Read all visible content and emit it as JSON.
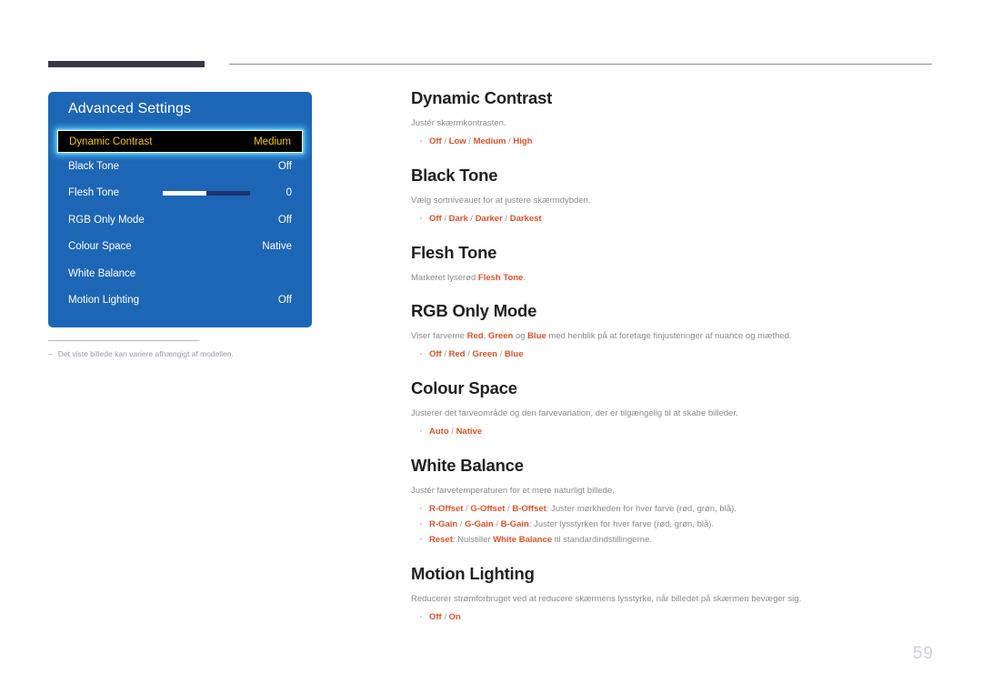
{
  "page": {
    "number": "59"
  },
  "osd": {
    "title": "Advanced Settings",
    "rows": [
      {
        "label": "Dynamic Contrast",
        "value": "Medium",
        "selected": true,
        "slider": false
      },
      {
        "label": "Black Tone",
        "value": "Off",
        "selected": false,
        "slider": false
      },
      {
        "label": "Flesh Tone",
        "value": "0",
        "selected": false,
        "slider": true
      },
      {
        "label": "RGB Only Mode",
        "value": "Off",
        "selected": false,
        "slider": false
      },
      {
        "label": "Colour Space",
        "value": "Native",
        "selected": false,
        "slider": false
      },
      {
        "label": "White Balance",
        "value": "",
        "selected": false,
        "slider": false
      },
      {
        "label": "Motion Lighting",
        "value": "Off",
        "selected": false,
        "slider": false
      }
    ],
    "slider_value_percent": 50
  },
  "footnote": {
    "dash": "–",
    "text": "Det viste billede kan variere afhængigt af modellen."
  },
  "sections": [
    {
      "title": "Dynamic Contrast",
      "desc": "Justér skærmkontrasten.",
      "bullets": [
        {
          "options": [
            "Off",
            "Low",
            "Medium",
            "High"
          ],
          "trail": ""
        }
      ]
    },
    {
      "title": "Black Tone",
      "desc": "Vælg sortniveauet for at justere skærmdybden.",
      "bullets": [
        {
          "options": [
            "Off",
            "Dark",
            "Darker",
            "Darkest"
          ],
          "trail": ""
        }
      ]
    },
    {
      "title": "Flesh Tone",
      "desc_parts": [
        {
          "text": "Markeret lyserød ",
          "accent": false
        },
        {
          "text": "Flesh Tone",
          "accent": true
        },
        {
          "text": ".",
          "accent": false
        }
      ],
      "bullets": []
    },
    {
      "title": "RGB Only Mode",
      "desc_parts": [
        {
          "text": "Viser farverne ",
          "accent": false
        },
        {
          "text": "Red",
          "accent": true
        },
        {
          "text": ", ",
          "accent": false
        },
        {
          "text": "Green",
          "accent": true
        },
        {
          "text": " og ",
          "accent": false
        },
        {
          "text": "Blue",
          "accent": true
        },
        {
          "text": " med henblik på at foretage finjusteringer af nuance og mæthed.",
          "accent": false
        }
      ],
      "bullets": [
        {
          "options": [
            "Off",
            "Red",
            "Green",
            "Blue"
          ],
          "trail": ""
        }
      ]
    },
    {
      "title": "Colour Space",
      "desc": "Justerer det farveområde og den farvevariation, der er tilgængelig til at skabe billeder.",
      "bullets": [
        {
          "options": [
            "Auto",
            "Native"
          ],
          "trail": ""
        }
      ]
    },
    {
      "title": "White Balance",
      "desc": "Justér farvetemperaturen for et mere naturligt billede.",
      "bullets": [
        {
          "options": [
            "R-Offset",
            "G-Offset",
            "B-Offset"
          ],
          "trail": ": Juster mørkheden for hver farve (rød, grøn, blå)."
        },
        {
          "options": [
            "R-Gain",
            "G-Gain",
            "B-Gain"
          ],
          "trail": ": Juster lysstyrken for hver farve (rød, grøn, blå)."
        },
        {
          "options": [
            "Reset"
          ],
          "trail_parts": [
            {
              "text": ": Nulstiller ",
              "accent": false
            },
            {
              "text": "White Balance",
              "accent": true
            },
            {
              "text": " til standardindstillingerne.",
              "accent": false
            }
          ]
        }
      ]
    },
    {
      "title": "Motion Lighting",
      "desc": "Reducerer strømforbruget ved at reducere skærmens lysstyrke, når billedet på skærmen bevæger sig.",
      "bullets": [
        {
          "options": [
            "Off",
            "On"
          ],
          "trail": ""
        }
      ]
    }
  ]
}
